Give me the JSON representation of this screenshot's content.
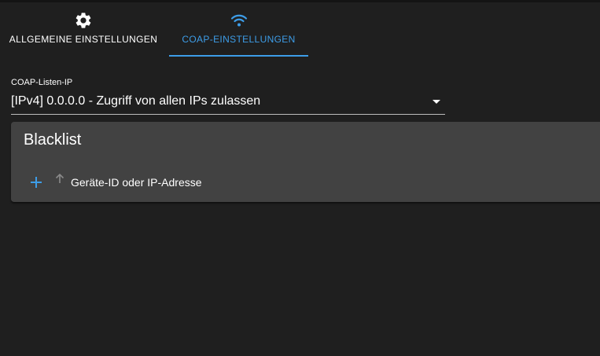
{
  "tabs": {
    "general": {
      "label": "ALLGEMEINE EINSTELLUNGEN",
      "icon": "gear-icon"
    },
    "coap": {
      "label": "COAP-EINSTELLUNGEN",
      "icon": "wifi-icon",
      "active": true
    }
  },
  "listen_ip": {
    "label": "COAP-Listen-IP",
    "value": "[IPv4] 0.0.0.0 - Zugriff von allen IPs zulassen"
  },
  "blacklist": {
    "title": "Blacklist",
    "column_header": "Geräte-ID oder IP-Adresse",
    "add_icon": "plus-icon",
    "sort_icon": "arrow-up-icon"
  },
  "colors": {
    "background": "#1f1f1f",
    "panel": "#424242",
    "accent": "#3d9de8",
    "text": "#ffffff"
  }
}
